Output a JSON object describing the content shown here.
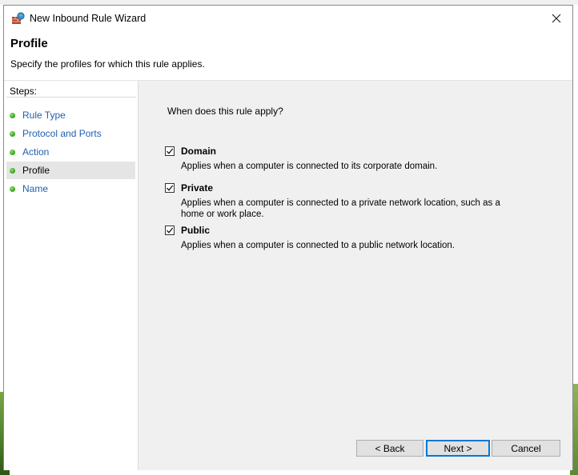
{
  "window": {
    "title": "New Inbound Rule Wizard",
    "close_glyph": "✕"
  },
  "header": {
    "title": "Profile",
    "subtitle": "Specify the profiles for which this rule applies."
  },
  "steps": {
    "label": "Steps:",
    "items": [
      {
        "label": "Rule Type",
        "active": false
      },
      {
        "label": "Protocol and Ports",
        "active": false
      },
      {
        "label": "Action",
        "active": false
      },
      {
        "label": "Profile",
        "active": true
      },
      {
        "label": "Name",
        "active": false
      }
    ]
  },
  "content": {
    "question": "When does this rule apply?",
    "options": [
      {
        "title": "Domain",
        "checked": true,
        "description": "Applies when a computer is connected to its corporate domain."
      },
      {
        "title": "Private",
        "checked": true,
        "description": "Applies when a computer is connected to a private network location, such as a home or work place."
      },
      {
        "title": "Public",
        "checked": true,
        "description": "Applies when a computer is connected to a public network location."
      }
    ]
  },
  "buttons": {
    "back": "< Back",
    "next": "Next >",
    "cancel": "Cancel"
  },
  "colors": {
    "link": "#1f5fae",
    "step_dot": "#3fae27",
    "focus_border": "#0078d7",
    "pane_bg": "#f0f0f0"
  },
  "icons": {
    "title": "firewall-wizard-icon",
    "close": "close-icon",
    "check": "checkmark-icon",
    "step": "green-dot-icon"
  }
}
